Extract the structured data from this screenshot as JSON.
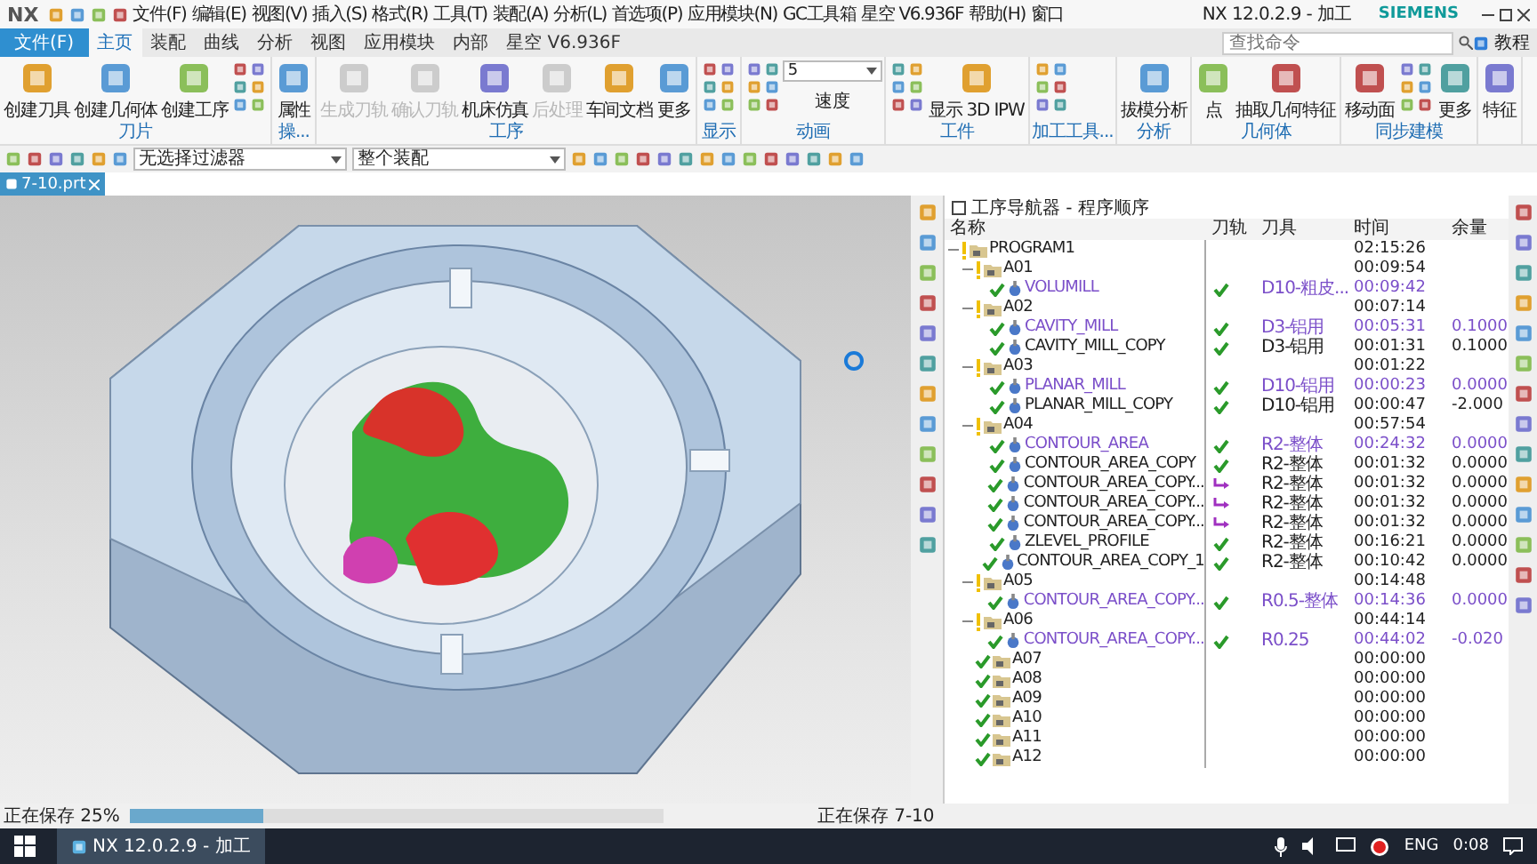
{
  "title_bar": {
    "logo": "NX",
    "menus": [
      "文件(F)",
      "编辑(E)",
      "视图(V)",
      "插入(S)",
      "格式(R)",
      "工具(T)",
      "装配(A)",
      "分析(L)",
      "首选项(P)",
      "应用模块(N)",
      "GC工具箱",
      "星空 V6.936F",
      "帮助(H)",
      "窗口"
    ],
    "title": "NX 12.0.2.9 - 加工",
    "brand": "SIEMENS"
  },
  "tabs": {
    "file_button": "文件(F)",
    "items": [
      {
        "label": "主页",
        "selected": true
      },
      {
        "label": "装配",
        "selected": false
      },
      {
        "label": "曲线",
        "selected": false
      },
      {
        "label": "分析",
        "selected": false
      },
      {
        "label": "视图",
        "selected": false
      },
      {
        "label": "应用模块",
        "selected": false
      },
      {
        "label": "内部",
        "selected": false
      },
      {
        "label": "星空 V6.936F",
        "selected": false
      }
    ],
    "search": {
      "placeholder": "查找命令"
    },
    "help_label": "教程"
  },
  "ribbon": [
    {
      "label": "刀片",
      "items": [
        {
          "kind": "large",
          "label": "创建刀具",
          "disabled": false
        },
        {
          "kind": "large",
          "label": "创建几何体",
          "disabled": false
        },
        {
          "kind": "large",
          "label": "创建工序",
          "disabled": false
        },
        {
          "kind": "icons"
        }
      ]
    },
    {
      "label": "操...",
      "items": [
        {
          "kind": "large",
          "label": "属性",
          "disabled": false
        }
      ]
    },
    {
      "label": "工序",
      "items": [
        {
          "kind": "large",
          "label": "生成刀轨",
          "disabled": true
        },
        {
          "kind": "large",
          "label": "确认刀轨",
          "disabled": true
        },
        {
          "kind": "large",
          "label": "机床仿真",
          "disabled": false
        },
        {
          "kind": "large",
          "label": "后处理",
          "disabled": true
        },
        {
          "kind": "large",
          "label": "车间文档",
          "disabled": false
        },
        {
          "kind": "large",
          "label": "更多",
          "disabled": false
        }
      ]
    },
    {
      "label": "显示",
      "items": [
        {
          "kind": "icons"
        }
      ]
    },
    {
      "label": "动画",
      "items": [
        {
          "kind": "icons"
        },
        {
          "kind": "select",
          "value": "5",
          "label": "速度"
        }
      ]
    },
    {
      "label": "工件",
      "items": [
        {
          "kind": "icons"
        },
        {
          "kind": "large",
          "label": "显示 3D IPW",
          "disabled": false
        }
      ]
    },
    {
      "label": "加工工具...",
      "items": [
        {
          "kind": "icons"
        }
      ]
    },
    {
      "label": "分析",
      "items": [
        {
          "kind": "large",
          "label": "拔模分析",
          "disabled": false
        }
      ]
    },
    {
      "label": "几何体",
      "items": [
        {
          "kind": "large",
          "label": "点",
          "disabled": false
        },
        {
          "kind": "large",
          "label": "抽取几何特征",
          "disabled": false
        }
      ]
    },
    {
      "label": "同步建模",
      "items": [
        {
          "kind": "large",
          "label": "移动面",
          "disabled": false
        },
        {
          "kind": "icons"
        },
        {
          "kind": "large",
          "label": "更多",
          "disabled": false
        }
      ]
    },
    {
      "items": [
        {
          "kind": "large",
          "label": "特征",
          "disabled": false
        }
      ]
    }
  ],
  "filters": {
    "selection_filter": "无选择过滤器",
    "scope": "整个装配"
  },
  "document_tab": {
    "label": "7-10.prt"
  },
  "navigator": {
    "title": "工序导航器 - 程序顺序",
    "columns": [
      "名称",
      "刀轨",
      "刀具",
      "时间",
      "余量"
    ],
    "rows": [
      {
        "name": "PROGRAM1",
        "kind": "group",
        "complete": false,
        "time": "02:15:26",
        "highlighted": false,
        "children": [
          {
            "name": "A01",
            "kind": "group",
            "complete": false,
            "time": "00:09:54",
            "highlighted": false,
            "children": [
              {
                "name": "VOLUMILL",
                "kind": "operation",
                "complete": true,
                "toolpath_current": true,
                "tool": "D10-粗皮...",
                "time": "00:09:42",
                "highlighted": true
              }
            ]
          },
          {
            "name": "A02",
            "kind": "group",
            "complete": false,
            "time": "00:07:14",
            "highlighted": false,
            "children": [
              {
                "name": "CAVITY_MILL",
                "kind": "operation",
                "complete": true,
                "toolpath_current": true,
                "tool": "D3-铝用",
                "time": "00:05:31",
                "stock": "0.1000",
                "highlighted": true
              },
              {
                "name": "CAVITY_MILL_COPY",
                "kind": "operation",
                "complete": true,
                "toolpath_current": true,
                "tool": "D3-铝用",
                "time": "00:01:31",
                "stock": "0.1000",
                "highlighted": false
              }
            ]
          },
          {
            "name": "A03",
            "kind": "group",
            "complete": false,
            "time": "00:01:22",
            "highlighted": false,
            "children": [
              {
                "name": "PLANAR_MILL",
                "kind": "operation",
                "complete": true,
                "toolpath_current": true,
                "tool": "D10-铝用",
                "time": "00:00:23",
                "stock": "0.0000",
                "highlighted": true
              },
              {
                "name": "PLANAR_MILL_COPY",
                "kind": "operation",
                "complete": true,
                "toolpath_current": true,
                "tool": "D10-铝用",
                "time": "00:00:47",
                "stock": "-2.000",
                "highlighted": false
              }
            ]
          },
          {
            "name": "A04",
            "kind": "group",
            "complete": false,
            "time": "00:57:54",
            "highlighted": false,
            "children": [
              {
                "name": "CONTOUR_AREA",
                "kind": "operation",
                "complete": true,
                "toolpath_current": true,
                "tool": "R2-整体",
                "time": "00:24:32",
                "stock": "0.0000",
                "highlighted": true
              },
              {
                "name": "CONTOUR_AREA_COPY",
                "kind": "operation",
                "complete": true,
                "toolpath_current": true,
                "tool": "R2-整体",
                "time": "00:01:32",
                "stock": "0.0000",
                "highlighted": false
              },
              {
                "name": "CONTOUR_AREA_COPY...",
                "kind": "operation",
                "complete": true,
                "toolpath_current": false,
                "tool": "R2-整体",
                "time": "00:01:32",
                "stock": "0.0000",
                "highlighted": false
              },
              {
                "name": "CONTOUR_AREA_COPY...",
                "kind": "operation",
                "complete": true,
                "toolpath_current": false,
                "tool": "R2-整体",
                "time": "00:01:32",
                "stock": "0.0000",
                "highlighted": false
              },
              {
                "name": "CONTOUR_AREA_COPY...",
                "kind": "operation",
                "complete": true,
                "toolpath_current": false,
                "tool": "R2-整体",
                "time": "00:01:32",
                "stock": "0.0000",
                "highlighted": false
              },
              {
                "name": "ZLEVEL_PROFILE",
                "kind": "operation",
                "complete": true,
                "toolpath_current": true,
                "tool": "R2-整体",
                "time": "00:16:21",
                "stock": "0.0000",
                "highlighted": false
              },
              {
                "name": "CONTOUR_AREA_COPY_1",
                "kind": "operation",
                "complete": true,
                "toolpath_current": true,
                "tool": "R2-整体",
                "time": "00:10:42",
                "stock": "0.0000",
                "highlighted": false
              }
            ]
          },
          {
            "name": "A05",
            "kind": "group",
            "complete": false,
            "time": "00:14:48",
            "highlighted": false,
            "children": [
              {
                "name": "CONTOUR_AREA_COPY...",
                "kind": "operation",
                "complete": true,
                "toolpath_current": true,
                "tool": "R0.5-整体",
                "time": "00:14:36",
                "stock": "0.0000",
                "highlighted": true
              }
            ]
          },
          {
            "name": "A06",
            "kind": "group",
            "complete": false,
            "time": "00:44:14",
            "highlighted": false,
            "children": [
              {
                "name": "CONTOUR_AREA_COPY...",
                "kind": "operation",
                "complete": true,
                "toolpath_current": true,
                "tool": "R0.25",
                "time": "00:44:02",
                "stock": "-0.020",
                "highlighted": true
              }
            ]
          },
          {
            "name": "A07",
            "kind": "group",
            "complete": true,
            "time": "00:00:00",
            "highlighted": false
          },
          {
            "name": "A08",
            "kind": "group",
            "complete": true,
            "time": "00:00:00",
            "highlighted": false
          },
          {
            "name": "A09",
            "kind": "group",
            "complete": true,
            "time": "00:00:00",
            "highlighted": false
          },
          {
            "name": "A10",
            "kind": "group",
            "complete": true,
            "time": "00:00:00",
            "highlighted": false
          },
          {
            "name": "A11",
            "kind": "group",
            "complete": true,
            "time": "00:00:00",
            "highlighted": false
          },
          {
            "name": "A12",
            "kind": "group",
            "complete": true,
            "time": "00:00:00",
            "highlighted": false
          }
        ]
      }
    ]
  },
  "status_bar": {
    "progress_label": "正在保存 25%",
    "level": 0.25,
    "message": "正在保存 7-10"
  },
  "taskbar": {
    "app": "NX 12.0.2.9 - 加工",
    "language": "ENG",
    "clock": "0:08"
  }
}
